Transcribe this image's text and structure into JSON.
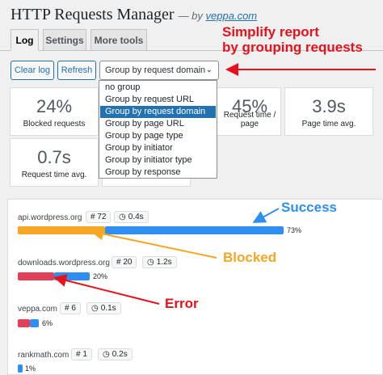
{
  "header": {
    "title": "HTTP Requests Manager",
    "by_prefix": "— by ",
    "by_link": "veppa.com"
  },
  "tabs": [
    {
      "label": "Log",
      "active": true
    },
    {
      "label": "Settings",
      "active": false
    },
    {
      "label": "More tools",
      "active": false
    }
  ],
  "toolbar": {
    "clear_label": "Clear log",
    "refresh_label": "Refresh",
    "group_selected": "Group by request domain",
    "group_options": [
      "no group",
      "Group by request URL",
      "Group by request domain",
      "Group by page URL",
      "Group by page type",
      "Group by initiator",
      "Group by initiator type",
      "Group by response"
    ]
  },
  "stats": [
    {
      "value": "24%",
      "label": "Blocked requests"
    },
    {
      "value": "45%",
      "label": "Request time / page"
    },
    {
      "value": "3.9s",
      "label": "Page time avg."
    },
    {
      "value": "0.7s",
      "label": "Request time avg."
    }
  ],
  "rows": [
    {
      "domain": "api.wordpress.org",
      "count": "# 72",
      "time": "0.4s",
      "percent": "73%",
      "blocked": 0.083,
      "error": 0,
      "success": 0.243
    },
    {
      "domain": "downloads.wordpress.org",
      "count": "# 20",
      "time": "1.2s",
      "percent": "20%",
      "blocked": 0,
      "error": 0.033,
      "success": 0.034
    },
    {
      "domain": "veppa.com",
      "count": "# 6",
      "time": "0.1s",
      "percent": "6%",
      "blocked": 0,
      "error": 0.016,
      "success": 0.0
    },
    {
      "domain": "rankmath.com",
      "count": "# 1",
      "time": "0.2s",
      "percent": "1%",
      "blocked": 0,
      "error": 0,
      "success": 0.0
    }
  ],
  "annotations": {
    "simplify": "Simplify report",
    "grouping": "by grouping requests",
    "success": "Success",
    "blocked": "Blocked",
    "error": "Error"
  },
  "colors": {
    "success": "#2e8ff0",
    "blocked": "#f5a623",
    "error": "#e04058",
    "annotation_red": "#e8101a",
    "annotation_blue": "#2e8ff0",
    "annotation_orange": "#f5a623",
    "link": "#2271b1"
  }
}
